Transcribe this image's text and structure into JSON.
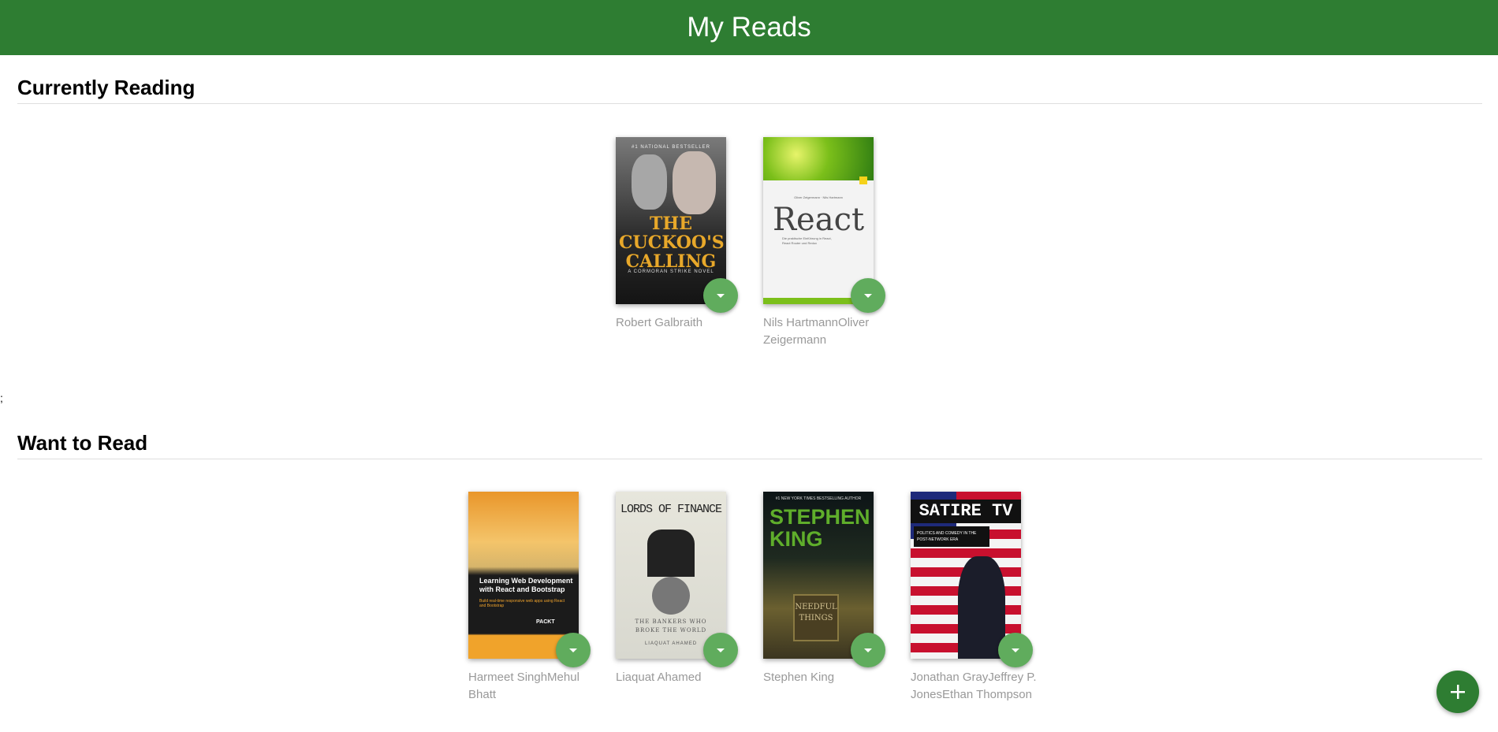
{
  "header": {
    "title": "My Reads"
  },
  "stray_text": ";",
  "shelves": [
    {
      "title": "Currently Reading",
      "books": [
        {
          "authors": "Robert Galbraith",
          "cover": {
            "top_line": "#1 NATIONAL BESTSELLER",
            "title": "THE CUCKOO'S CALLING",
            "subtitle": "A CORMORAN STRIKE NOVEL"
          }
        },
        {
          "authors": "Nils HartmannOliver Zeigermann",
          "cover": {
            "top_line": "Oliver Zeigermann · Nils Hartmann",
            "title": "React",
            "subtitle": "Die praktische Einführung in React, React Router und Redux"
          }
        }
      ]
    },
    {
      "title": "Want to Read",
      "books": [
        {
          "authors": "Harmeet SinghMehul Bhatt",
          "cover": {
            "title": "Learning Web Development with React and Bootstrap",
            "subtitle": "Build real-time responsive web apps using React and Bootstrap",
            "badge": "PACKT"
          }
        },
        {
          "authors": "Liaquat Ahamed",
          "cover": {
            "title": "LORDS OF FINANCE",
            "subtitle": "THE BANKERS WHO BROKE THE WORLD",
            "bottom": "LIAQUAT AHAMED"
          }
        },
        {
          "authors": "Stephen King",
          "cover": {
            "top_line": "#1 NEW YORK TIMES BESTSELLING AUTHOR",
            "title": "STEPHEN KING",
            "subtitle": "NEEDFUL THINGS"
          }
        },
        {
          "authors": "Jonathan GrayJeffrey P. JonesEthan Thompson",
          "cover": {
            "title": "SATIRE TV",
            "subtitle": "POLITICS AND COMEDY IN THE POST-NETWORK ERA"
          }
        }
      ]
    }
  ],
  "colors": {
    "header": "#2e7d32",
    "changer": "#60ac5d",
    "author_text": "#999999"
  },
  "icons": {
    "changer": "caret-down-icon",
    "add": "plus-icon"
  }
}
